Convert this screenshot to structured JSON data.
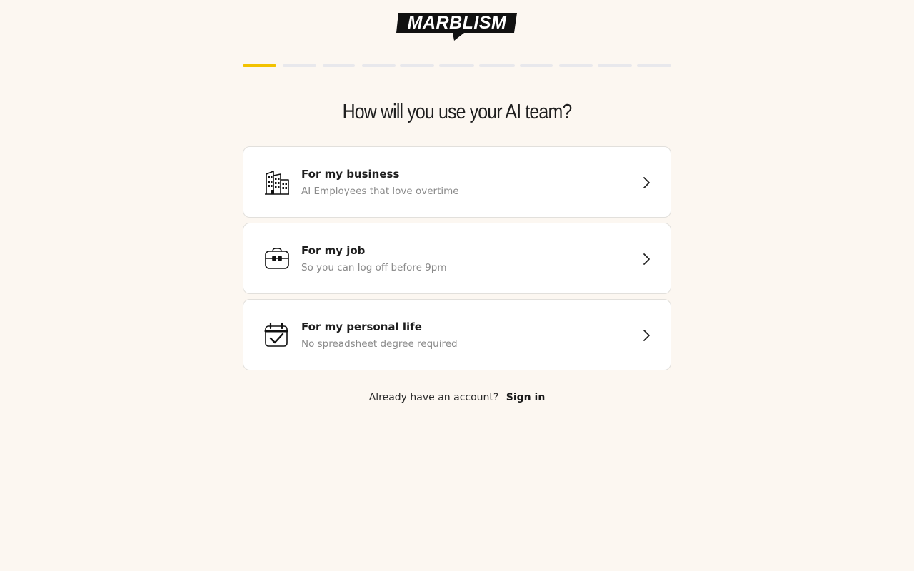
{
  "brand": {
    "logo_text": "MARBLISM"
  },
  "progress": {
    "total_steps": 11,
    "current_step": 1,
    "accent_color": "#f2c200"
  },
  "page": {
    "title": "How will you use your AI team?"
  },
  "options": [
    {
      "label": "For my business",
      "subtitle": "AI Employees that love overtime",
      "icon": "office-building-icon"
    },
    {
      "label": "For my job",
      "subtitle": "So you can log off before 9pm",
      "icon": "briefcase-icon"
    },
    {
      "label": "For my personal life",
      "subtitle": "No spreadsheet degree required",
      "icon": "calendar-check-icon"
    }
  ],
  "footer": {
    "prompt": "Already have an account?",
    "signin_label": "Sign in"
  }
}
